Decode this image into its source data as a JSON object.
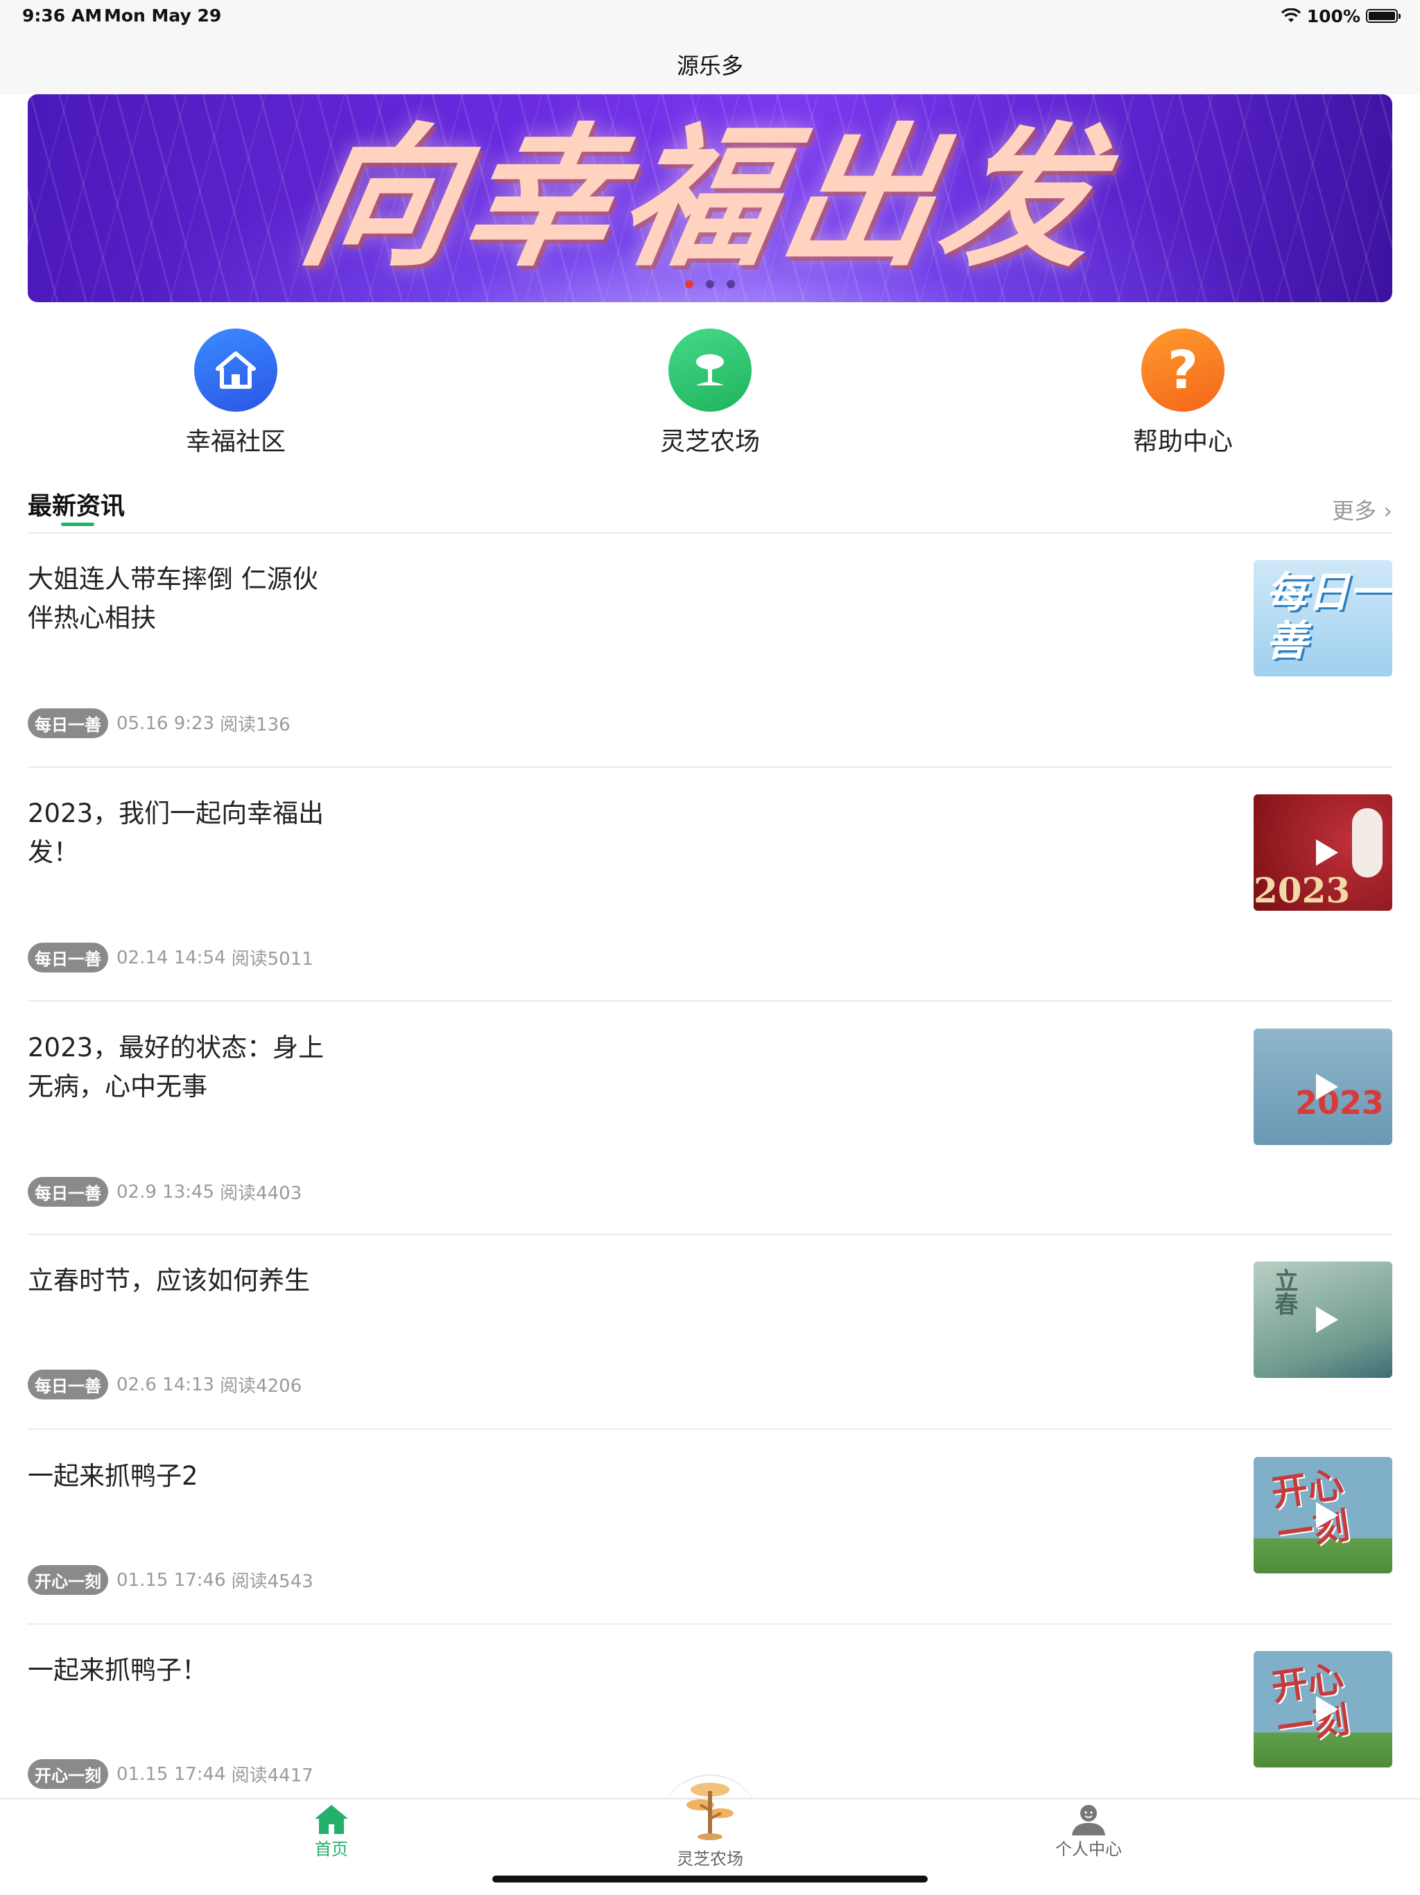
{
  "status_bar": {
    "time": "9:36 AM",
    "date": "Mon May 29",
    "battery": "100%",
    "wifi_icon": "wifi-icon",
    "battery_level": 1.0
  },
  "nav": {
    "title": "源乐多"
  },
  "banner": {
    "text": "向幸福出发",
    "dots": 3,
    "active_dot": 0
  },
  "quick_menu": [
    {
      "label": "幸福社区",
      "icon": "home-icon",
      "color": "#2f6df0"
    },
    {
      "label": "灵芝农场",
      "icon": "tree-icon",
      "color": "#2cc66e"
    },
    {
      "label": "帮助中心",
      "icon": "question-icon",
      "color": "#fb7a1c"
    }
  ],
  "news_section": {
    "title": "最新资讯",
    "more": "更多"
  },
  "news": [
    {
      "title": "大姐连人带车摔倒 仁源伙伴热心相扶",
      "tag": "每日一善",
      "date": "05.16 9:23",
      "reads": "阅读136",
      "thumb_text": "每日一善",
      "video": false
    },
    {
      "title": "2023，我们一起向幸福出发！",
      "tag": "每日一善",
      "date": "02.14 14:54",
      "reads": "阅读5011",
      "thumb_text": "2023",
      "video": true
    },
    {
      "title": "2023，最好的状态：身上无病，心中无事",
      "tag": "每日一善",
      "date": "02.9 13:45",
      "reads": "阅读4403",
      "thumb_text": "2023",
      "video": true
    },
    {
      "title": "立春时节，应该如何养生",
      "tag": "每日一善",
      "date": "02.6 14:13",
      "reads": "阅读4206",
      "thumb_text": "立春",
      "video": true
    },
    {
      "title": "一起来抓鸭子2",
      "tag": "开心一刻",
      "date": "01.15 17:46",
      "reads": "阅读4543",
      "thumb_text": "开心一刻",
      "video": true
    },
    {
      "title": "一起来抓鸭子！",
      "tag": "开心一刻",
      "date": "01.15 17:44",
      "reads": "阅读4417",
      "thumb_text": "开心一刻",
      "video": true
    }
  ],
  "tab_bar": {
    "tabs": [
      {
        "label": "首页",
        "icon": "home-icon",
        "active": true
      },
      {
        "label": "灵芝农场",
        "icon": "ganoderma-tree-icon",
        "active": false
      },
      {
        "label": "个人中心",
        "icon": "person-icon",
        "active": false
      }
    ],
    "active_color": "#22b06a"
  }
}
